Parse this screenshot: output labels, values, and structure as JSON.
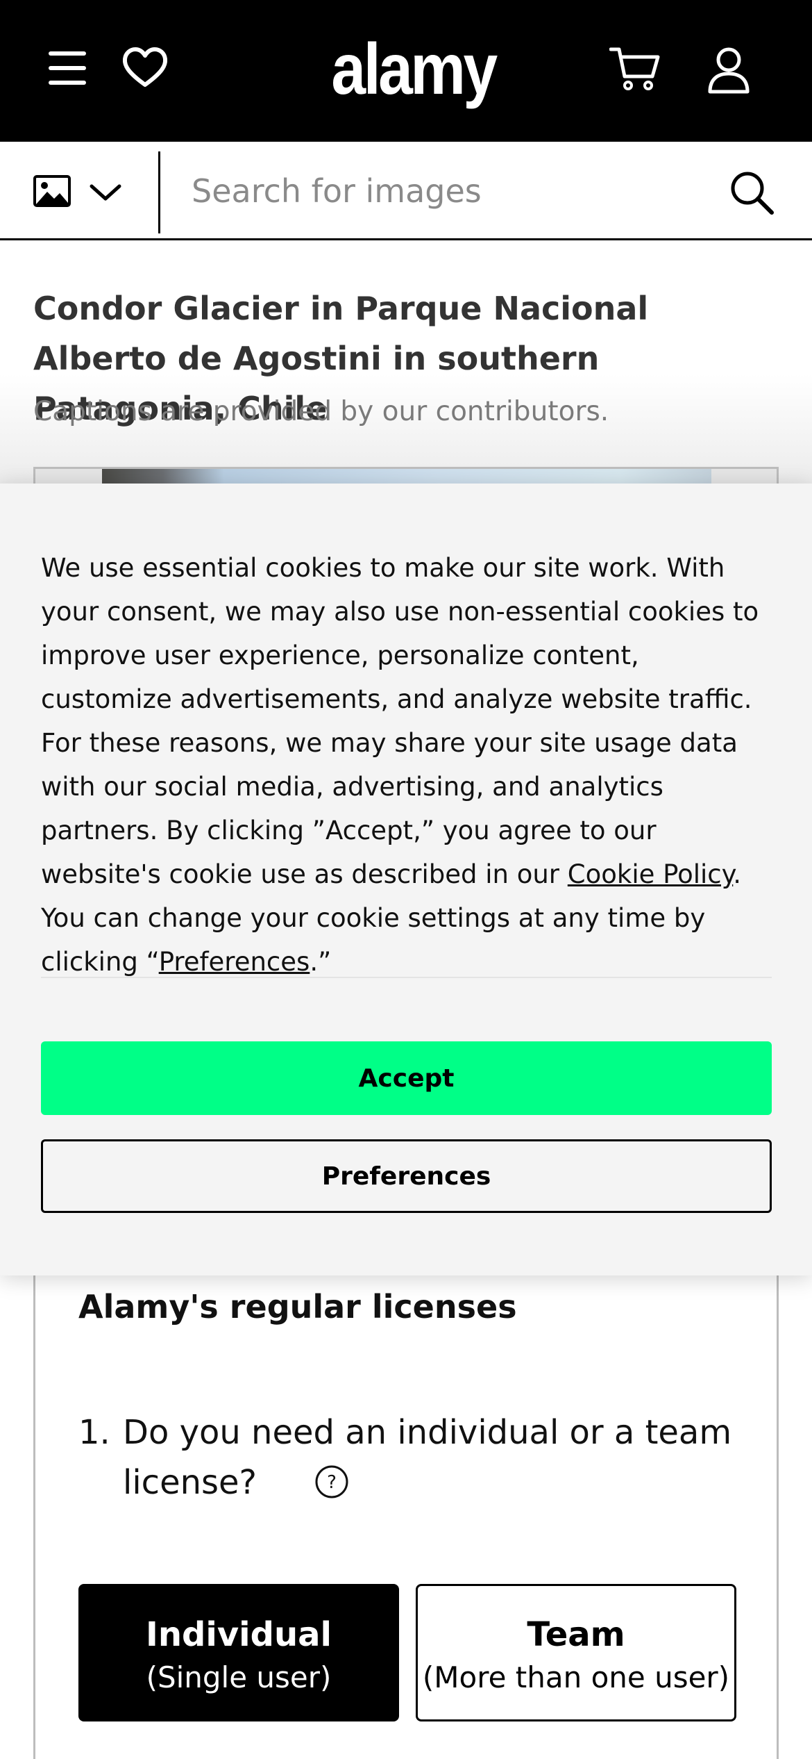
{
  "header": {
    "logo": "alamy",
    "icons": [
      "menu-icon",
      "heart-icon",
      "cart-icon",
      "user-icon"
    ]
  },
  "search": {
    "placeholder": "Search for images",
    "type_icon": "image-icon"
  },
  "image_page": {
    "title": "Condor Glacier in Parque Nacional Alberto de Agostini in southern Patagonia, Chile",
    "caption_note": "Captions are provided by our contributors."
  },
  "cookie_banner": {
    "text_part1": "We use essential cookies to make our site work. With your consent, we may also use non-essential cookies to improve user experience, personalize content, customize advertisements, and analyze website traffic. For these reasons, we may share your site usage data with our social media, advertising, and analytics partners. By clicking ”Accept,” you agree to our website's cookie use as described in our ",
    "cookie_policy_link": "Cookie Policy",
    "text_part2": ". You can change your cookie settings at any time by clicking “",
    "preferences_link": "Preferences",
    "text_part3": ".”",
    "accept_label": "Accept",
    "preferences_label": "Preferences",
    "accept_color": "#00ff87"
  },
  "licenses": {
    "heading": "Alamy's regular licenses",
    "question_number": "1.",
    "question": "Do you need an individual or a team license?",
    "options": [
      {
        "title": "Individual",
        "subtitle": "(Single user)",
        "selected": true
      },
      {
        "title": "Team",
        "subtitle": "(More than one user)",
        "selected": false
      }
    ]
  }
}
